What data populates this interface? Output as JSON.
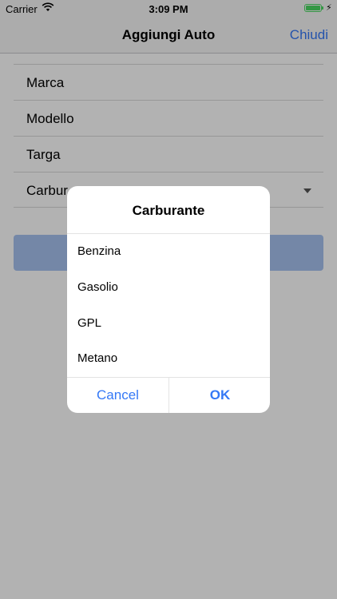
{
  "status_bar": {
    "carrier": "Carrier",
    "time": "3:09 PM",
    "wifi_icon": "wifi-icon",
    "battery_icon": "battery-icon",
    "charging_icon": "charging-bolt-icon",
    "battery_color": "#4cd964"
  },
  "nav": {
    "title": "Aggiungi Auto",
    "close_label": "Chiudi",
    "accent_color": "#3478f6"
  },
  "form": {
    "fields": [
      {
        "label": "Marca"
      },
      {
        "label": "Modello"
      },
      {
        "label": "Targa"
      },
      {
        "label": "Carbur"
      }
    ],
    "dropdown_icon": "chevron-down-icon"
  },
  "dialog": {
    "title": "Carburante",
    "options": [
      "Benzina",
      "Gasolio",
      "GPL",
      "Metano"
    ],
    "cancel_label": "Cancel",
    "ok_label": "OK"
  }
}
